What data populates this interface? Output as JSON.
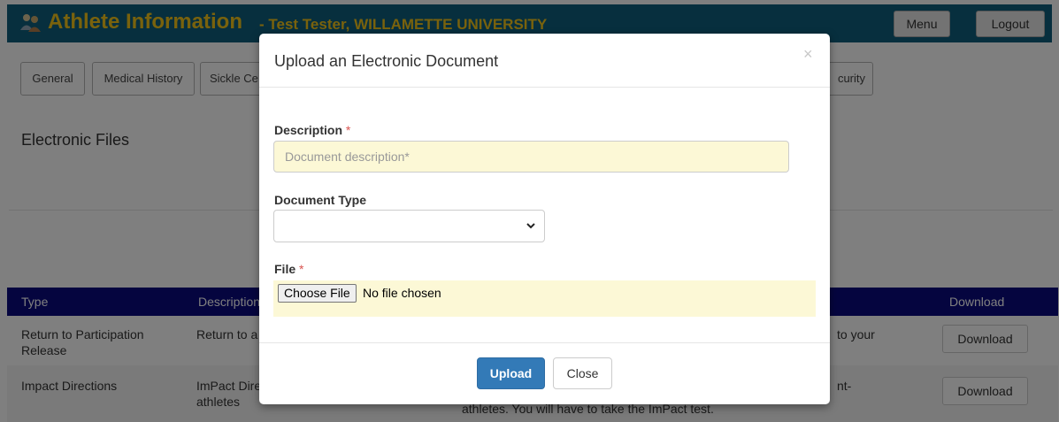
{
  "header": {
    "title": "Athlete Information",
    "subtitle": "- Test Tester, WILLAMETTE UNIVERSITY",
    "menu_label": "Menu",
    "logout_label": "Logout",
    "logo_icon": "users-icon"
  },
  "tabs": [
    {
      "label": "General"
    },
    {
      "label": "Medical History"
    },
    {
      "label": "Sickle Ce"
    },
    {
      "label": "curity"
    }
  ],
  "section_title": "Electronic Files",
  "table": {
    "headers": [
      "Type",
      "Description",
      "Download"
    ],
    "rows": [
      {
        "type": "Return to Participation Release",
        "description": "Return to a",
        "note": "to your",
        "download": "Download"
      },
      {
        "type": "Impact Directions",
        "description": "ImPact Dire athletes",
        "note": "nt-",
        "note2": "athletes. You will have to take the ImPact test.",
        "download": "Download"
      }
    ]
  },
  "modal": {
    "title": "Upload an Electronic Document",
    "close_symbol": "×",
    "description_label": "Description",
    "description_placeholder": "Document description*",
    "description_value": "",
    "doc_type_label": "Document Type",
    "doc_type_value": "",
    "file_label": "File",
    "required_mark": "*",
    "choose_file_label": "Choose File",
    "no_file_text": "No file chosen",
    "upload_label": "Upload",
    "close_label": "Close"
  },
  "colors": {
    "header_bg": "#0f5f7c",
    "header_text": "#f2c41a",
    "table_header_bg": "#0a0a7e",
    "primary_button": "#337ab7",
    "input_highlight": "#fcf8d6"
  }
}
